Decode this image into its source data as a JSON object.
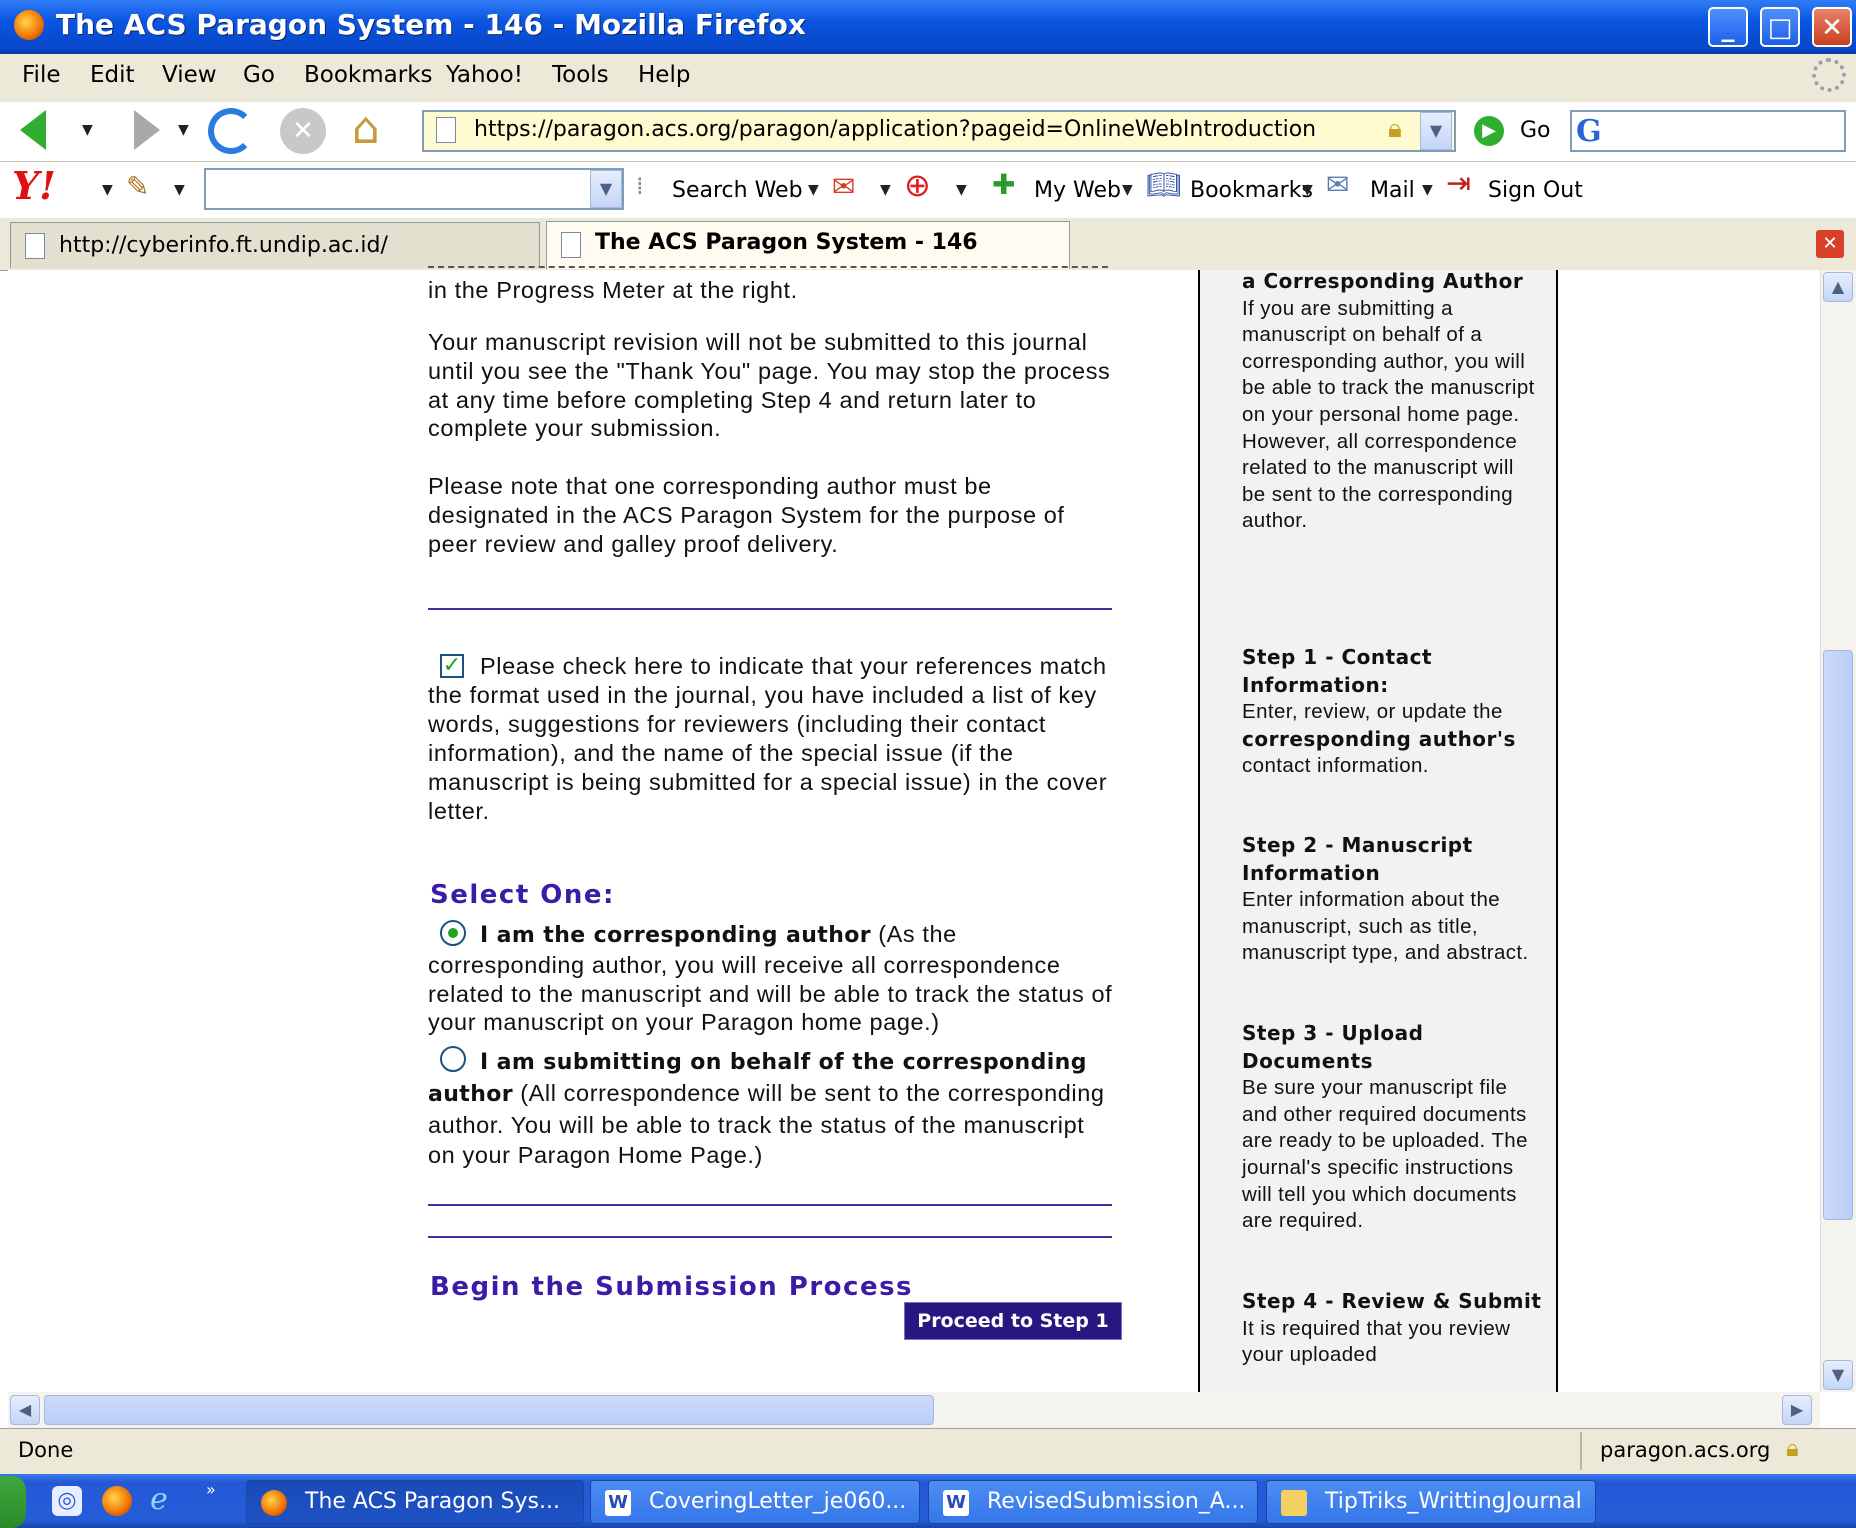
{
  "window": {
    "title": "The ACS Paragon System - 146 - Mozilla Firefox"
  },
  "menu": [
    "File",
    "Edit",
    "View",
    "Go",
    "Bookmarks",
    "Yahoo!",
    "Tools",
    "Help"
  ],
  "navbar": {
    "url": "https://paragon.acs.org/paragon/application?pageid=OnlineWebIntroduction",
    "go_label": "Go"
  },
  "yahoo_toolbar": {
    "search_web": "Search Web",
    "my_web": "My Web",
    "bookmarks": "Bookmarks",
    "mail": "Mail",
    "sign_out": "Sign Out"
  },
  "tabs": [
    {
      "label": "http://cyberinfo.ft.undip.ac.id/"
    },
    {
      "label": "The ACS Paragon System - 146"
    }
  ],
  "main": {
    "cut_top": "in the Progress Meter at the right.",
    "para_revision": "Your manuscript revision will not be submitted to this journal until you see the \"Thank You\" page. You may stop the process at any time before completing Step 4 and return later to complete your submission.",
    "para_note": "Please note that one corresponding author must be designated in the ACS Paragon System for the purpose of peer review and galley proof delivery.",
    "check_text": "Please check here to indicate that your references match the format used in the journal, you have included a list of key words, suggestions for reviewers (including their contact information), and the name of the special issue (if the manuscript is being submitted for a special issue) in the cover letter.",
    "select_one": "Select One:",
    "radio1_bold": "I am the corresponding author",
    "radio1_text": "(As the corresponding author, you will receive all correspondence related to the manuscript and will be able to track the status of your manuscript on your Paragon home page.)",
    "radio2_bold": "I am submitting on behalf of the corresponding author",
    "radio2_text": "(All correspondence will be sent to the corresponding author. You will be able to track the status of the manuscript on your Paragon Home Page.)",
    "begin_heading": "Begin the Submission Process",
    "proceed_button": "Proceed to Step 1"
  },
  "sidebar": {
    "corr_title": "a Corresponding Author",
    "corr_text": "If you are submitting a manuscript on behalf of a corresponding author, you will be able to track the manuscript on your personal home page. However, all correspondence related to the manuscript will be sent to the corresponding author.",
    "step1_title": "Step 1 - Contact Information:",
    "step1_pre": "Enter, review, or update the",
    "step1_bold": "corresponding author's",
    "step1_post": "contact information.",
    "step2_title": "Step 2 - Manuscript Information",
    "step2_text": "Enter information about the manuscript, such as title, manuscript type, and abstract.",
    "step3_title": "Step 3 - Upload Documents",
    "step3_text": "Be sure your manuscript file and other required documents are ready to be uploaded. The journal's specific instructions will tell you which documents are required.",
    "step4_title": "Step 4 - Review & Submit",
    "step4_text": "It is required that you review your uploaded"
  },
  "status": {
    "left": "Done",
    "right": "paragon.acs.org"
  },
  "taskbar": [
    "The ACS Paragon Sys...",
    "CoveringLetter_je060...",
    "RevisedSubmission_A...",
    "TipTriks_WrittingJournal"
  ],
  "colors": {
    "accent": "#3a1ca6",
    "button": "#2a1680",
    "titlebar": "#0a55e0"
  }
}
